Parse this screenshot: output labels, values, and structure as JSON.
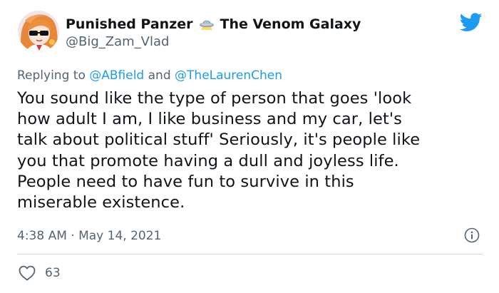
{
  "author": {
    "display_name": "Punished Panzer",
    "display_name_suffix": "The Venom Galaxy",
    "handle": "@Big_Zam_Vlad",
    "name_emoji": "ufo-icon"
  },
  "reply": {
    "prefix": "Replying to",
    "mention_1": "@ABfield",
    "joiner": "and",
    "mention_2": "@TheLaurenChen"
  },
  "tweet": {
    "text": "You sound like the type of person that goes 'look\nhow adult I am, I like business and my car, let's\ntalk about political stuff' Seriously, it's people like\nyou that promote having a dull and joyless life.\nPeople need to have fun to survive in this\nmiserable existence.",
    "timestamp": "4:38 AM · May 14, 2021",
    "likes": "63"
  },
  "icons": {
    "brand": "twitter-bird-icon",
    "info": "info-icon",
    "like": "heart-icon"
  },
  "colors": {
    "accent": "#1d9bf0",
    "text": "#0f1419",
    "muted": "#536471",
    "divider": "#cfd9de"
  }
}
